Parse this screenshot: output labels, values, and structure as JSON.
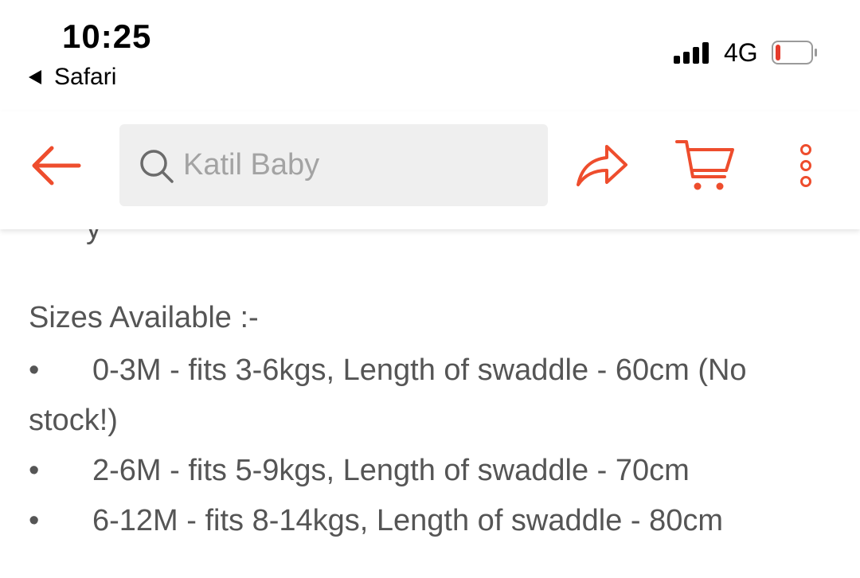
{
  "status_bar": {
    "time": "10:25",
    "back_app": "Safari",
    "network": "4G",
    "battery_level": 0.15,
    "battery_color": "#e53b2c"
  },
  "header": {
    "back_icon": "arrow-left-icon",
    "search_placeholder": "Katil Baby",
    "search_icon": "search-icon",
    "share_icon": "share-arrow-icon",
    "cart_icon": "cart-icon",
    "more_icon": "more-vertical-icon",
    "accent_color": "#ee4d2d"
  },
  "content": {
    "partial_text": "y",
    "heading": "Sizes Available :-",
    "bullet_symbol": "•",
    "items": [
      "0-3M - fits 3-6kgs, Length of swaddle - 60cm (No stock!)",
      "2-6M - fits 5-9kgs, Length of swaddle - 70cm",
      "6-12M - fits 8-14kgs, Length of swaddle - 80cm"
    ]
  }
}
